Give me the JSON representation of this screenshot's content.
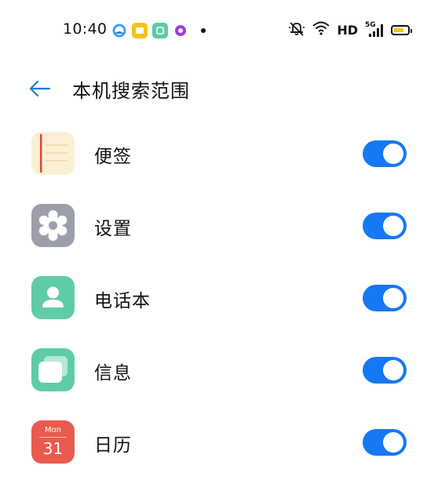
{
  "status_bar": {
    "time": "10:40",
    "network_label": "HD",
    "signal_label": "5G",
    "battery_color": "#f5c518",
    "notification_icons": [
      "cloud-app-icon",
      "notes-app-icon",
      "calendar-app-icon",
      "podcast-app-icon"
    ]
  },
  "header": {
    "title": "本机搜索范围",
    "back_icon": "arrow-left-icon",
    "accent": "#1e7be0"
  },
  "items": [
    {
      "label": "便签",
      "icon": "notes-icon",
      "enabled": true
    },
    {
      "label": "设置",
      "icon": "settings-gear-icon",
      "enabled": true
    },
    {
      "label": "电话本",
      "icon": "contacts-icon",
      "enabled": true
    },
    {
      "label": "信息",
      "icon": "messages-icon",
      "enabled": true
    },
    {
      "label": "日历",
      "icon": "calendar-icon",
      "enabled": true,
      "month": "Mon",
      "day": "31"
    }
  ],
  "toggle_color": "#1678f2"
}
